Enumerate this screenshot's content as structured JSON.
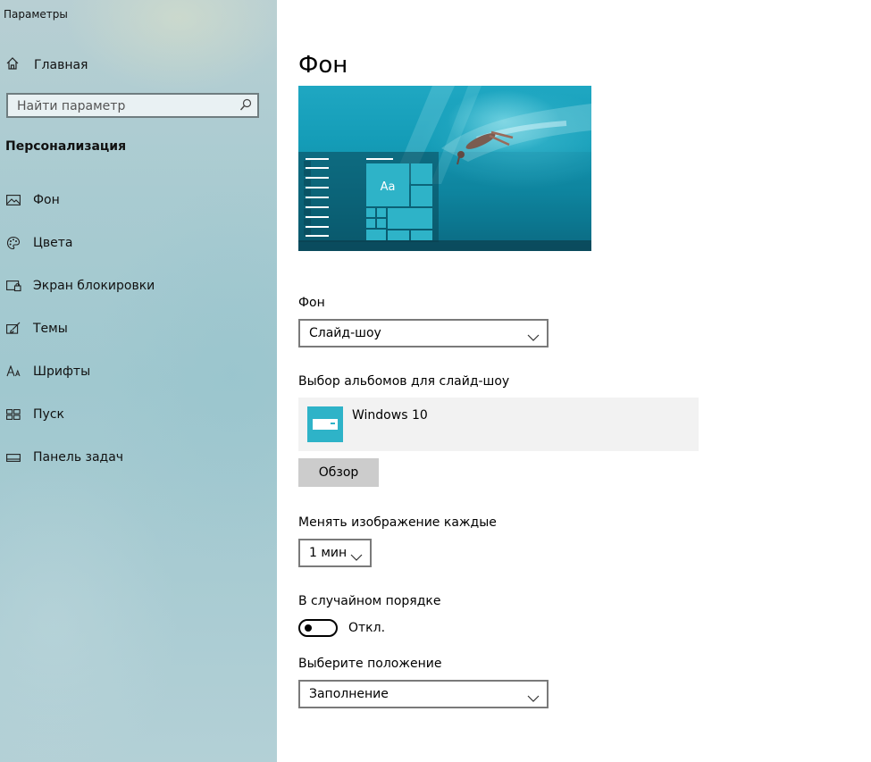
{
  "window": {
    "title": "Параметры"
  },
  "sidebar": {
    "home_label": "Главная",
    "search_placeholder": "Найти параметр",
    "section_title": "Персонализация",
    "items": [
      {
        "label": "Фон",
        "icon": "picture-icon"
      },
      {
        "label": "Цвета",
        "icon": "palette-icon"
      },
      {
        "label": "Экран блокировки",
        "icon": "lock-screen-icon"
      },
      {
        "label": "Темы",
        "icon": "themes-brush-icon"
      },
      {
        "label": "Шрифты",
        "icon": "fonts-icon"
      },
      {
        "label": "Пуск",
        "icon": "start-tiles-icon"
      },
      {
        "label": "Панель задач",
        "icon": "taskbar-icon"
      }
    ]
  },
  "main": {
    "title": "Фон",
    "preview_tile_text": "Aa",
    "background": {
      "label": "Фон",
      "value": "Слайд-шоу"
    },
    "albums": {
      "label": "Выбор альбомов для слайд-шоу",
      "album_name": "Windows 10",
      "browse_label": "Обзор"
    },
    "interval": {
      "label": "Менять изображение каждые",
      "value": "1 мин"
    },
    "shuffle": {
      "label": "В случайном порядке",
      "state": "Откл."
    },
    "fit": {
      "label": "Выберите положение",
      "value": "Заполнение"
    }
  },
  "colors": {
    "accent": "#2eb3c8",
    "sidebar_bg": "#a9cbd1",
    "album_bg": "#f2f2f2",
    "button_bg": "#cccccc"
  }
}
